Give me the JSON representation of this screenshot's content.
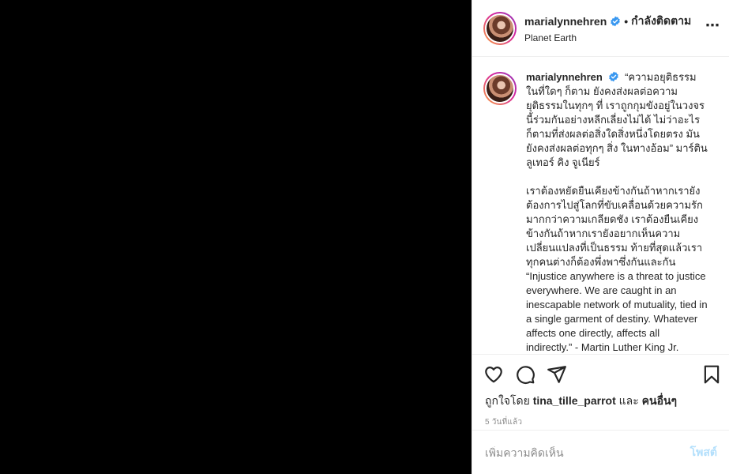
{
  "header": {
    "username": "marialynnehren",
    "separator": "•",
    "follow_status": "กำลังติดตาม",
    "location": "Planet Earth",
    "more_icon": "⋯"
  },
  "caption": {
    "username": "marialynnehren",
    "paragraph1": "“ความอยุติธรรมในที่ใดๆ ก็ตาม ยังคงส่งผลต่อความยุติธรรมในทุกๆ ที่ เราถูกกุมขังอยู่ในวงจรนี้ร่วมกันอย่างหลีกเลี่ยงไม่ได้ ไม่ว่าอะไรก็ตามที่ส่งผลต่อสิ่งใดสิ่งหนึ่งโดยตรง มันยังคงส่งผลต่อทุกๆ สิ่ง ในทางอ้อม” มาร์ติน ลูเทอร์ คิง จูเนียร์",
    "paragraph2": "เราต้องหยัดยืนเคียงข้างกันถ้าหากเรายังต้องการไปสู่โลกที่ขับเคลื่อนด้วยความรักมากกว่าความเกลียดชัง เราต้องยืนเคียงข้างกันถ้าหากเรายังอยากเห็นความเปลี่ยนแปลงที่เป็นธรรม ท้ายที่สุดแล้วเราทุกคนต่างก็ต้องพึ่งพาซึ่งกันและกัน “Injustice anywhere is a threat to justice everywhere. We are caught in an inescapable network of mutuality, tied in a single garment of destiny. Whatever affects one directly, affects all indirectly.” - Martin Luther King Jr."
  },
  "icons": {
    "like": "heart-icon",
    "comment": "comment-icon",
    "share": "share-icon",
    "save": "bookmark-icon"
  },
  "likes": {
    "prefix": "ถูกใจโดย",
    "user": "tina_tille_parrot",
    "conj": "และ",
    "others": "คนอื่นๆ"
  },
  "timestamp": "5 วันที่แล้ว",
  "comment_box": {
    "placeholder": "เพิ่มความคิดเห็น",
    "post_label": "โพสต์"
  },
  "colors": {
    "verified": "#3897f0",
    "post_disabled": "#b2dffc",
    "media_bg": "#000000"
  }
}
